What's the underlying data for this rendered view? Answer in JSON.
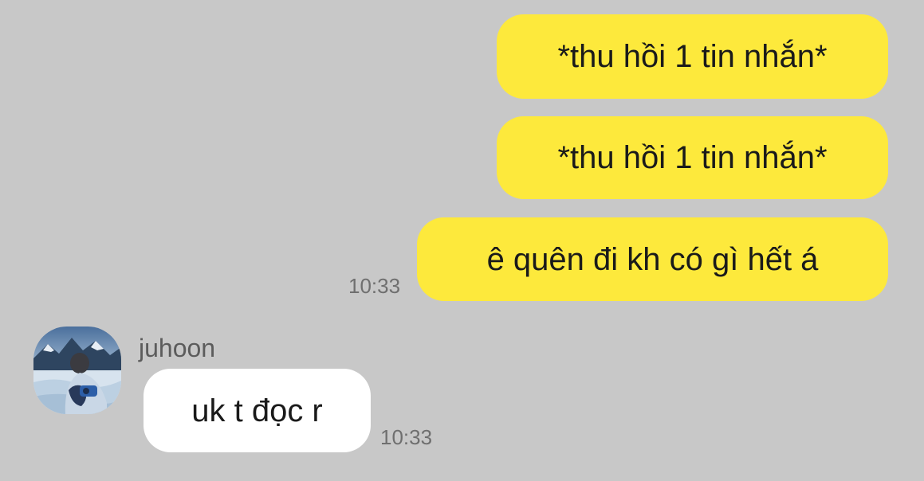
{
  "messages": {
    "outgoing": [
      {
        "text": "*thu hồi 1 tin nhắn*"
      },
      {
        "text": "*thu hồi 1 tin nhắn*"
      },
      {
        "text": "ê quên đi kh có gì hết á",
        "time": "10:33"
      }
    ],
    "incoming": [
      {
        "sender": "juhoon",
        "avatar_icon": "profile-photo-snowy-mountain",
        "text": "uk t đọc r",
        "time": "10:33"
      }
    ]
  },
  "colors": {
    "background": "#c8c8c8",
    "outgoing_bubble": "#fde93c",
    "incoming_bubble": "#ffffff",
    "timestamp": "#6f6f6f"
  }
}
